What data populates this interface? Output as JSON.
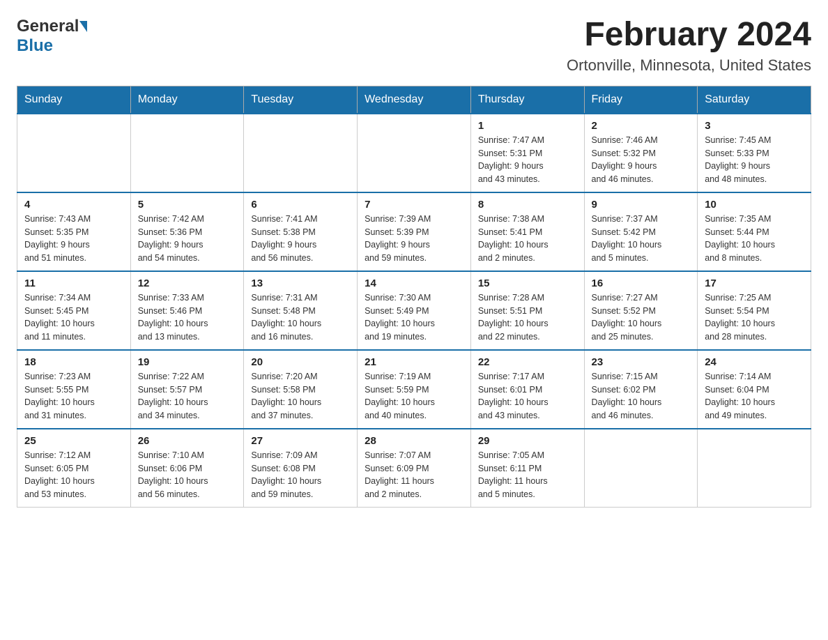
{
  "header": {
    "logo_general": "General",
    "logo_blue": "Blue",
    "month_title": "February 2024",
    "location": "Ortonville, Minnesota, United States"
  },
  "days_of_week": [
    "Sunday",
    "Monday",
    "Tuesday",
    "Wednesday",
    "Thursday",
    "Friday",
    "Saturday"
  ],
  "weeks": [
    [
      {
        "day": "",
        "info": ""
      },
      {
        "day": "",
        "info": ""
      },
      {
        "day": "",
        "info": ""
      },
      {
        "day": "",
        "info": ""
      },
      {
        "day": "1",
        "info": "Sunrise: 7:47 AM\nSunset: 5:31 PM\nDaylight: 9 hours\nand 43 minutes."
      },
      {
        "day": "2",
        "info": "Sunrise: 7:46 AM\nSunset: 5:32 PM\nDaylight: 9 hours\nand 46 minutes."
      },
      {
        "day": "3",
        "info": "Sunrise: 7:45 AM\nSunset: 5:33 PM\nDaylight: 9 hours\nand 48 minutes."
      }
    ],
    [
      {
        "day": "4",
        "info": "Sunrise: 7:43 AM\nSunset: 5:35 PM\nDaylight: 9 hours\nand 51 minutes."
      },
      {
        "day": "5",
        "info": "Sunrise: 7:42 AM\nSunset: 5:36 PM\nDaylight: 9 hours\nand 54 minutes."
      },
      {
        "day": "6",
        "info": "Sunrise: 7:41 AM\nSunset: 5:38 PM\nDaylight: 9 hours\nand 56 minutes."
      },
      {
        "day": "7",
        "info": "Sunrise: 7:39 AM\nSunset: 5:39 PM\nDaylight: 9 hours\nand 59 minutes."
      },
      {
        "day": "8",
        "info": "Sunrise: 7:38 AM\nSunset: 5:41 PM\nDaylight: 10 hours\nand 2 minutes."
      },
      {
        "day": "9",
        "info": "Sunrise: 7:37 AM\nSunset: 5:42 PM\nDaylight: 10 hours\nand 5 minutes."
      },
      {
        "day": "10",
        "info": "Sunrise: 7:35 AM\nSunset: 5:44 PM\nDaylight: 10 hours\nand 8 minutes."
      }
    ],
    [
      {
        "day": "11",
        "info": "Sunrise: 7:34 AM\nSunset: 5:45 PM\nDaylight: 10 hours\nand 11 minutes."
      },
      {
        "day": "12",
        "info": "Sunrise: 7:33 AM\nSunset: 5:46 PM\nDaylight: 10 hours\nand 13 minutes."
      },
      {
        "day": "13",
        "info": "Sunrise: 7:31 AM\nSunset: 5:48 PM\nDaylight: 10 hours\nand 16 minutes."
      },
      {
        "day": "14",
        "info": "Sunrise: 7:30 AM\nSunset: 5:49 PM\nDaylight: 10 hours\nand 19 minutes."
      },
      {
        "day": "15",
        "info": "Sunrise: 7:28 AM\nSunset: 5:51 PM\nDaylight: 10 hours\nand 22 minutes."
      },
      {
        "day": "16",
        "info": "Sunrise: 7:27 AM\nSunset: 5:52 PM\nDaylight: 10 hours\nand 25 minutes."
      },
      {
        "day": "17",
        "info": "Sunrise: 7:25 AM\nSunset: 5:54 PM\nDaylight: 10 hours\nand 28 minutes."
      }
    ],
    [
      {
        "day": "18",
        "info": "Sunrise: 7:23 AM\nSunset: 5:55 PM\nDaylight: 10 hours\nand 31 minutes."
      },
      {
        "day": "19",
        "info": "Sunrise: 7:22 AM\nSunset: 5:57 PM\nDaylight: 10 hours\nand 34 minutes."
      },
      {
        "day": "20",
        "info": "Sunrise: 7:20 AM\nSunset: 5:58 PM\nDaylight: 10 hours\nand 37 minutes."
      },
      {
        "day": "21",
        "info": "Sunrise: 7:19 AM\nSunset: 5:59 PM\nDaylight: 10 hours\nand 40 minutes."
      },
      {
        "day": "22",
        "info": "Sunrise: 7:17 AM\nSunset: 6:01 PM\nDaylight: 10 hours\nand 43 minutes."
      },
      {
        "day": "23",
        "info": "Sunrise: 7:15 AM\nSunset: 6:02 PM\nDaylight: 10 hours\nand 46 minutes."
      },
      {
        "day": "24",
        "info": "Sunrise: 7:14 AM\nSunset: 6:04 PM\nDaylight: 10 hours\nand 49 minutes."
      }
    ],
    [
      {
        "day": "25",
        "info": "Sunrise: 7:12 AM\nSunset: 6:05 PM\nDaylight: 10 hours\nand 53 minutes."
      },
      {
        "day": "26",
        "info": "Sunrise: 7:10 AM\nSunset: 6:06 PM\nDaylight: 10 hours\nand 56 minutes."
      },
      {
        "day": "27",
        "info": "Sunrise: 7:09 AM\nSunset: 6:08 PM\nDaylight: 10 hours\nand 59 minutes."
      },
      {
        "day": "28",
        "info": "Sunrise: 7:07 AM\nSunset: 6:09 PM\nDaylight: 11 hours\nand 2 minutes."
      },
      {
        "day": "29",
        "info": "Sunrise: 7:05 AM\nSunset: 6:11 PM\nDaylight: 11 hours\nand 5 minutes."
      },
      {
        "day": "",
        "info": ""
      },
      {
        "day": "",
        "info": ""
      }
    ]
  ]
}
